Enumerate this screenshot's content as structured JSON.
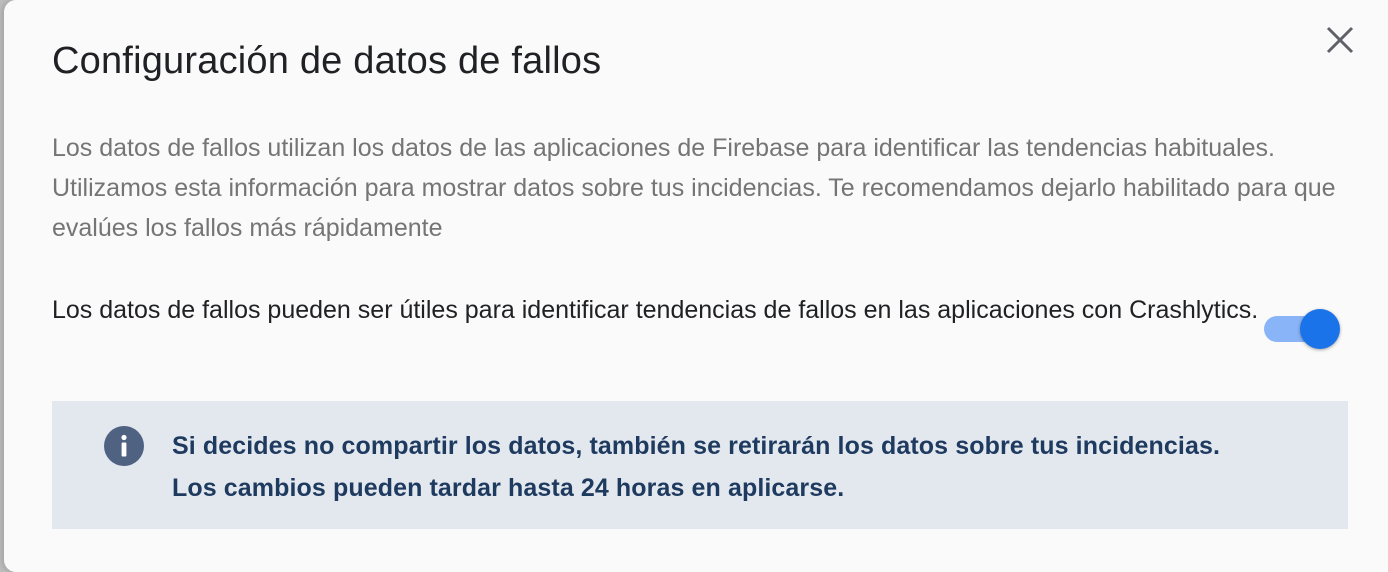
{
  "dialog": {
    "title": "Configuración de datos de fallos",
    "close_icon": "close-icon",
    "description": "Los datos de fallos utilizan los datos de las aplicaciones de Firebase para identificar las tendencias habituales. Utilizamos esta información para mostrar datos sobre tus incidencias. Te recomendamos dejarlo habilitado para que evalúes los fallos más rápidamente",
    "setting": {
      "label": "Los datos de fallos pueden ser útiles para identificar tendencias de fallos en las aplicaciones con Crashlytics.",
      "enabled": true
    },
    "info": {
      "icon": "info-icon",
      "line1": "Si decides no compartir los datos, también se retirarán los datos sobre tus incidencias.",
      "line2": "Los cambios pueden tardar hasta 24 horas en aplicarse."
    },
    "colors": {
      "accent": "#1a73e8",
      "accent_light": "#8ab4f8",
      "info_bg": "#e3e8ef",
      "info_text": "#1e3a5f"
    }
  }
}
